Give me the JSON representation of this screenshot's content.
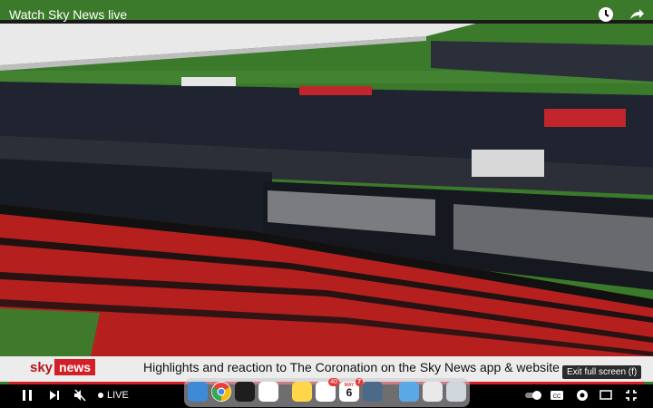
{
  "window": {
    "title": "Watch Sky News live"
  },
  "top_icons": [
    {
      "name": "clock-icon"
    },
    {
      "name": "share-icon"
    }
  ],
  "ticker": {
    "logo_sky": "sky",
    "logo_news": "news",
    "headline": "Highlights and reaction to The Coronation on the Sky News app & website",
    "watermark": "sky"
  },
  "tooltip": {
    "text": "Exit full screen (f)"
  },
  "controls": {
    "live_label": "LIVE",
    "progress_fraction": 1.0
  },
  "dock": {
    "calendar_month": "MAY",
    "calendar_day": "6",
    "badges": {
      "slack": "40",
      "calendar": "7"
    }
  },
  "colors": {
    "sky_red": "#d31f26",
    "ticker_bg": "#ececec",
    "grass": "#3f7a2c"
  }
}
